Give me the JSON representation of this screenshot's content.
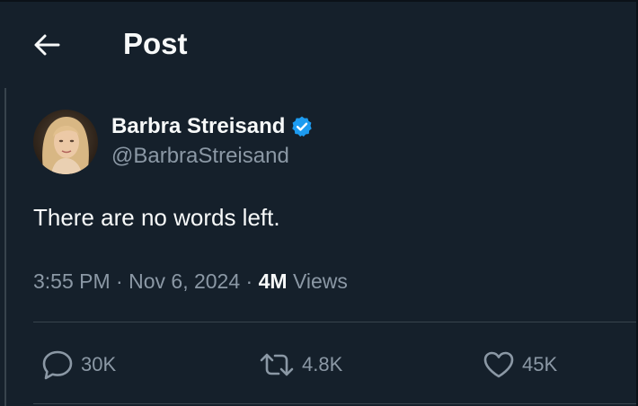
{
  "header": {
    "title": "Post",
    "back_icon": "arrow-left-icon"
  },
  "post": {
    "author": {
      "display_name": "Barbra Streisand",
      "handle": "@BarbraStreisand",
      "verified": true,
      "verified_icon": "verified-badge-icon",
      "verified_color": "#1d9bf0"
    },
    "text": "There are no words left.",
    "time": "3:55 PM",
    "date": "Nov 6, 2024",
    "separator": "·",
    "views_count": "4M",
    "views_label": "Views"
  },
  "actions": {
    "reply": {
      "icon": "reply-icon",
      "count": "30K"
    },
    "repost": {
      "icon": "repost-icon",
      "count": "4.8K"
    },
    "like": {
      "icon": "heart-icon",
      "count": "45K"
    }
  },
  "colors": {
    "background": "#15202b",
    "text_primary": "#f7f9f9",
    "text_secondary": "#8b98a5",
    "border": "#38444d"
  }
}
